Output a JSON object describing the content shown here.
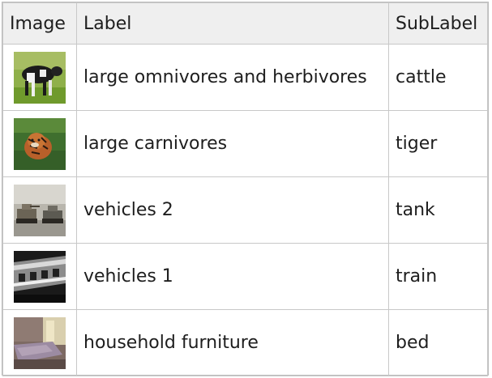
{
  "table": {
    "headers": [
      "Image",
      "Label",
      "SubLabel"
    ],
    "rows": [
      {
        "image": "cattle-thumbnail",
        "label": "large omnivores and herbivores",
        "sublabel": "cattle"
      },
      {
        "image": "tiger-thumbnail",
        "label": "large carnivores",
        "sublabel": "tiger"
      },
      {
        "image": "tank-thumbnail",
        "label": "vehicles 2",
        "sublabel": "tank"
      },
      {
        "image": "train-thumbnail",
        "label": "vehicles 1",
        "sublabel": "train"
      },
      {
        "image": "bed-thumbnail",
        "label": "household furniture",
        "sublabel": "bed"
      }
    ]
  }
}
